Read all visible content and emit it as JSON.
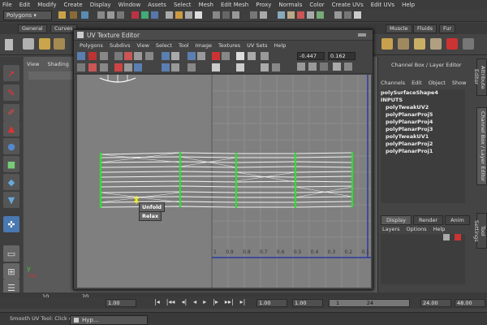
{
  "main_menu": [
    "File",
    "Edit",
    "Modify",
    "Create",
    "Display",
    "Window",
    "Assets",
    "Select",
    "Mesh",
    "Edit Mesh",
    "Proxy",
    "Normals",
    "Color",
    "Create UVs",
    "Edit UVs",
    "Help"
  ],
  "mode_dropdown": "Polygons",
  "shelf_tabs": [
    "General",
    "Curves",
    "Muscle",
    "Fluids",
    "Fur"
  ],
  "panel_menus": [
    "View",
    "Shading"
  ],
  "uv_editor": {
    "title": "UV Texture Editor",
    "menus": [
      "Polygons",
      "Subdivs",
      "View",
      "Select",
      "Tool",
      "Image",
      "Textures",
      "UV Sets",
      "Help"
    ],
    "u_value": "-0.447",
    "v_value": "0.162",
    "tick_labels": [
      "1",
      "0.9",
      "0.8",
      "0.7",
      "0.6",
      "0.5",
      "0.4",
      "0.3",
      "0.2",
      "0.1"
    ],
    "context_menu": [
      "Unfold",
      "Relax"
    ]
  },
  "channel_box": {
    "title": "Channel Box / Layer Editor",
    "menus": [
      "Channels",
      "Edit",
      "Object",
      "Show"
    ],
    "shape_name": "polySurfaceShape4",
    "inputs_label": "INPUTS",
    "inputs": [
      "polyTweakUV2",
      "polyPlanarProj5",
      "polyPlanarProj4",
      "polyPlanarProj3",
      "polyTweakUV1",
      "polyPlanarProj2",
      "polyPlanarProj1"
    ],
    "side_tabs": [
      "Attribute Editor",
      "Channel Box / Layer Editor",
      "Tool Settings"
    ],
    "layer_tabs": [
      "Display",
      "Render",
      "Anim"
    ],
    "layer_menus": [
      "Layers",
      "Options",
      "Help"
    ]
  },
  "timeline": {
    "tick_10": "10",
    "tick_20": "20"
  },
  "range_slider": {
    "start": "1.00",
    "current": "1.00",
    "range_start": "1.00",
    "range_field": "1",
    "range_end_label": "24",
    "end": "24.00",
    "end2": "48.00"
  },
  "help_line": "Smooth UV Tool: Click on",
  "taskbar_item": "Hyp..."
}
